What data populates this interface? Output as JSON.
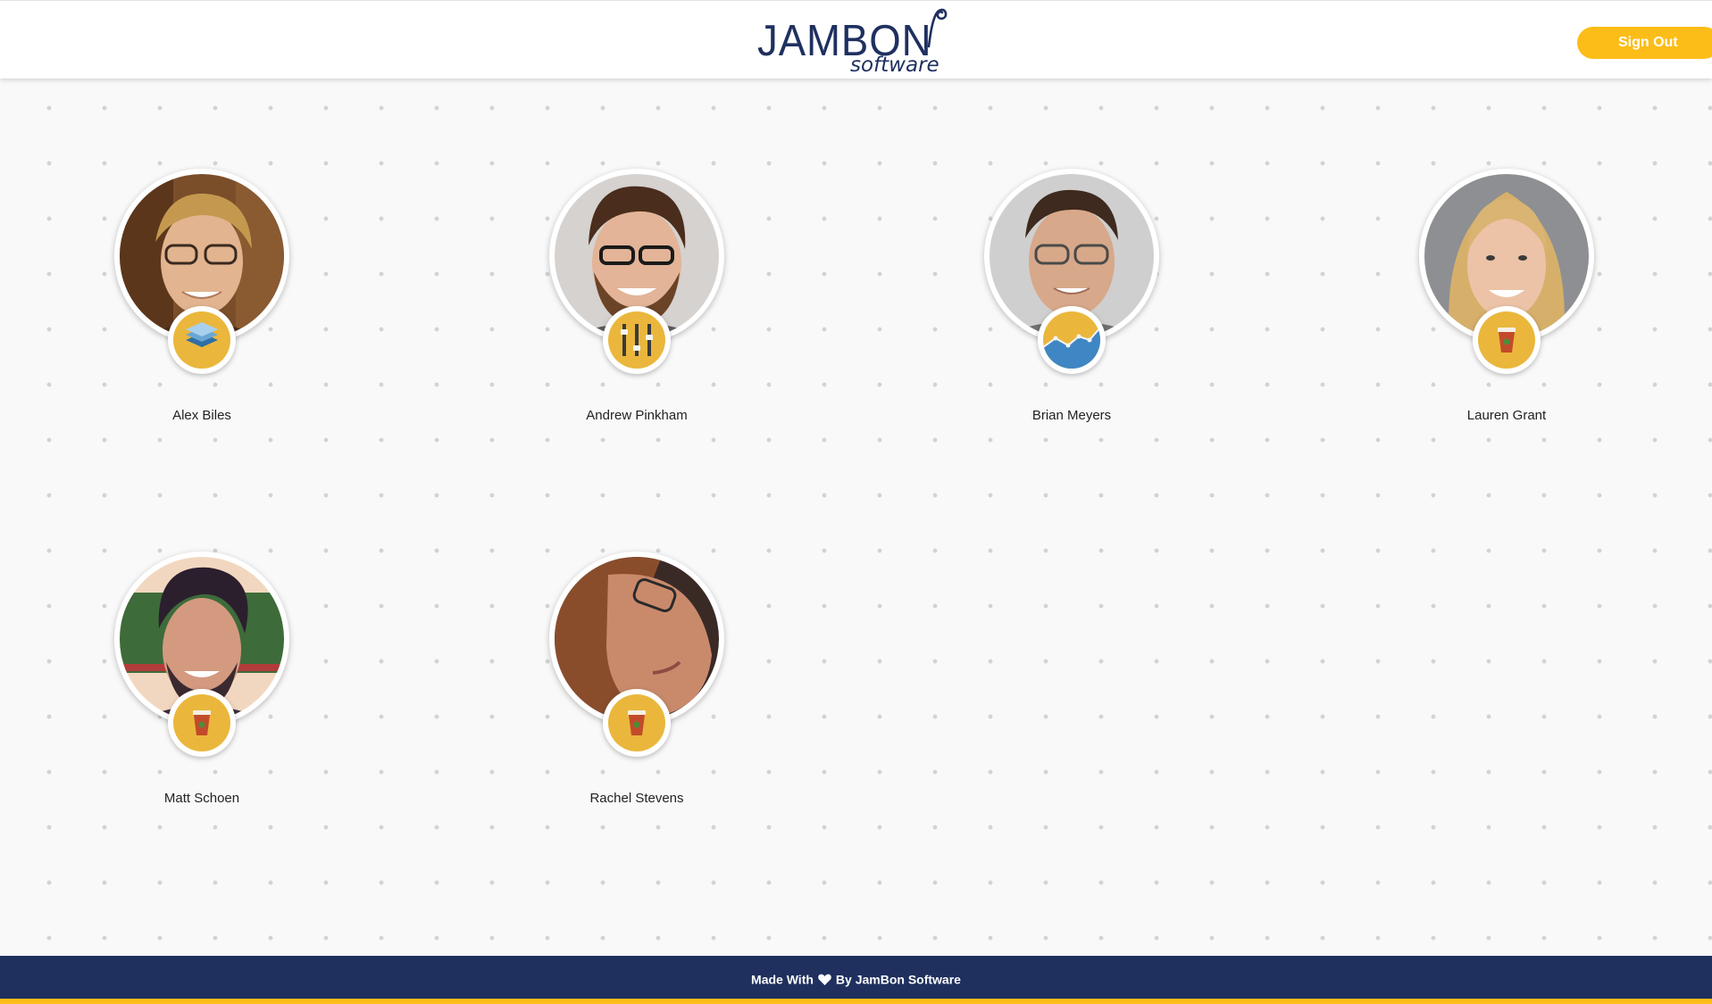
{
  "header": {
    "logo_main": "JAMBON",
    "logo_sub": "software",
    "signout_label": "Sign Out",
    "accent_color": "#fcbd18",
    "brand_color": "#1f3060"
  },
  "team": {
    "members": [
      {
        "name": "Alex Biles",
        "badge_icon": "layers-icon"
      },
      {
        "name": "Andrew Pinkham",
        "badge_icon": "sliders-icon"
      },
      {
        "name": "Brian Meyers",
        "badge_icon": "chart-icon"
      },
      {
        "name": "Lauren Grant",
        "badge_icon": "coffee-cup-icon"
      },
      {
        "name": "Matt Schoen",
        "badge_icon": "coffee-cup-icon"
      },
      {
        "name": "Rachel Stevens",
        "badge_icon": "coffee-cup-icon"
      }
    ]
  },
  "footer": {
    "made_with": "Made With",
    "by_text": "By JamBon Software",
    "heart_icon": "heart-icon",
    "background_color": "#1f305e"
  }
}
